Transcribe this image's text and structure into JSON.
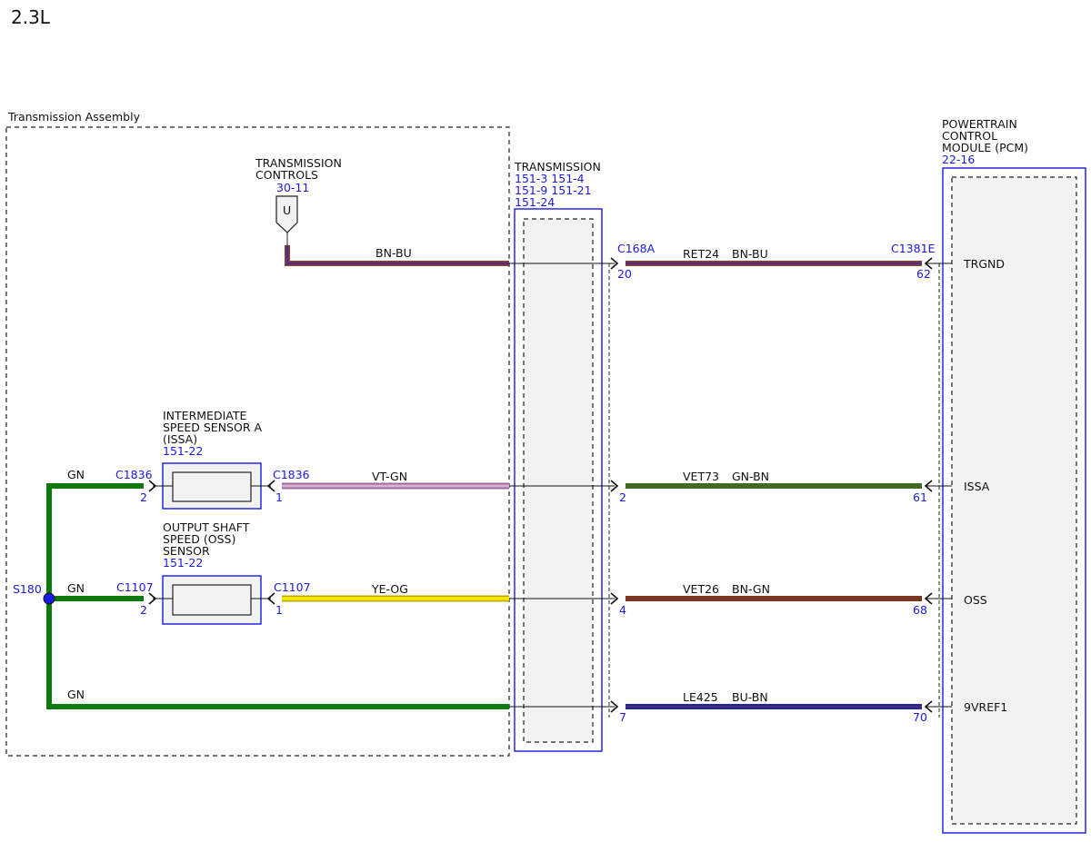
{
  "page": {
    "title": "2.3L"
  },
  "colors": {
    "box_blue": "#1a1ae6",
    "gn": "#0e7a0e",
    "dark_gn": "#3f6b22",
    "brown": "#7a3424",
    "bn_bu_a": "#8b3a2a",
    "bn_bu_b": "#3b2fa8",
    "vt_gn": "#c8a0c8",
    "ye_og": "#f2e600",
    "bu_bn": "#2020b8",
    "fill_gray": "#f2f2f2"
  },
  "transmission_assembly": {
    "label": "Transmission Assembly"
  },
  "transmission_controls": {
    "line1": "TRANSMISSION",
    "line2": "CONTROLS",
    "ref": "30-11",
    "symbol": "U"
  },
  "transmission_connector": {
    "line1": "TRANSMISSION",
    "ref1": "151-3 151-4",
    "ref2": "151-9  151-21",
    "ref3": "151-24"
  },
  "pcm": {
    "line1": "POWERTRAIN",
    "line2": "CONTROL",
    "line3": "MODULE (PCM)",
    "ref": "22-16"
  },
  "issa_sensor": {
    "line1": "INTERMEDIATE",
    "line2": "SPEED SENSOR A",
    "line3": "(ISSA)",
    "ref": "151-22",
    "left_conn": "C1836",
    "left_pin": "2",
    "right_conn": "C1836",
    "right_pin": "1"
  },
  "oss_sensor": {
    "line1": "OUTPUT SHAFT",
    "line2": "SPEED (OSS)",
    "line3": "SENSOR",
    "ref": "151-22",
    "left_conn": "C1107",
    "left_pin": "2",
    "right_conn": "C1107",
    "right_pin": "1"
  },
  "splice": {
    "label": "S180"
  },
  "circuits": {
    "trgnd": {
      "wire_color_left": "BN-BU",
      "conn_left": "C168A",
      "pin_left": "20",
      "circuit": "RET24",
      "wire_color": "BN-BU",
      "conn_right": "C1381E",
      "pin_right": "62",
      "signal": "TRGND"
    },
    "issa": {
      "wire_color_left": "VT-GN",
      "pin_left": "2",
      "circuit": "VET73",
      "wire_color": "GN-BN",
      "pin_right": "61",
      "signal": "ISSA",
      "gn_label": "GN"
    },
    "oss": {
      "wire_color_left": "YE-OG",
      "pin_left": "4",
      "circuit": "VET26",
      "wire_color": "BN-GN",
      "pin_right": "68",
      "signal": "OSS",
      "gn_label": "GN"
    },
    "vref": {
      "pin_left": "7",
      "circuit": "LE425",
      "wire_color": "BU-BN",
      "pin_right": "70",
      "signal": "9VREF1",
      "gn_label": "GN"
    }
  }
}
